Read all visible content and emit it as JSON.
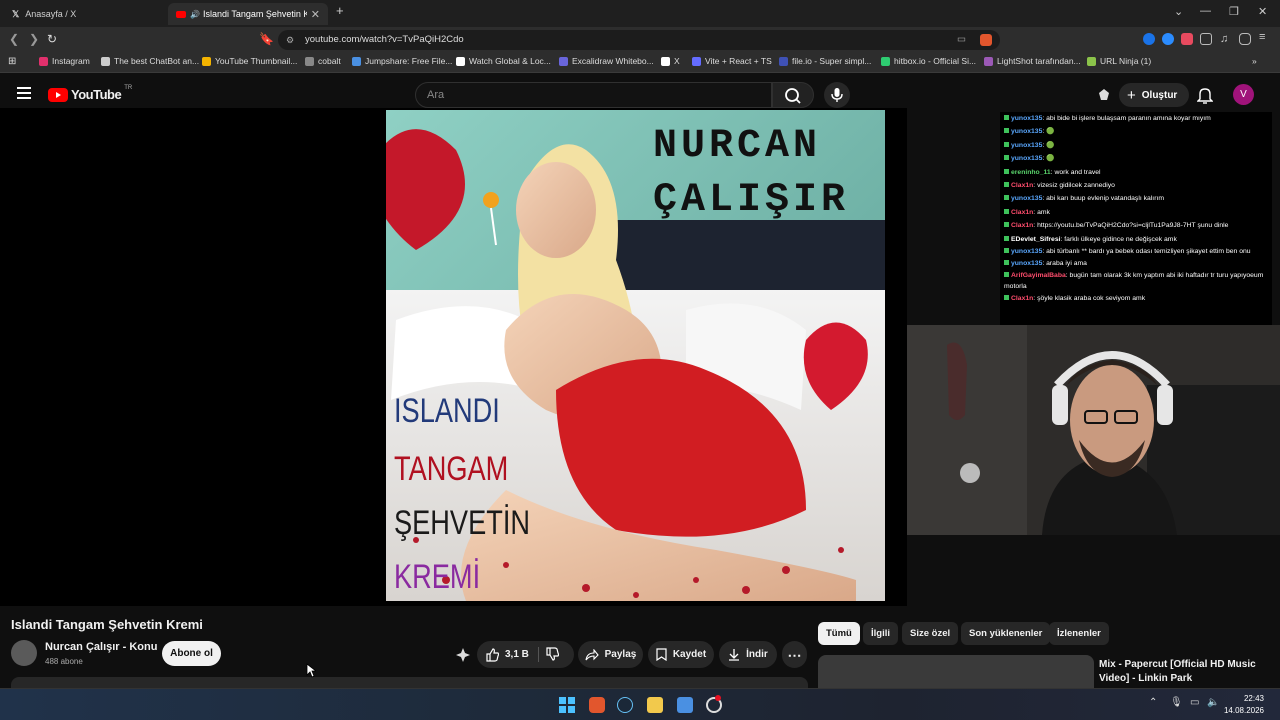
{
  "browser": {
    "tabs": [
      {
        "label": "Anasayfa / X"
      },
      {
        "label": "Islandi Tangam Şehvetin Kremi"
      }
    ],
    "url": "youtube.com/watch?v=TvPaQiH2Cdo",
    "bookmarks": [
      {
        "label": "Instagram",
        "color": "#e1306c"
      },
      {
        "label": "The best ChatBot an...",
        "color": "#cccccc"
      },
      {
        "label": "YouTube Thumbnail...",
        "color": "#f4b400"
      },
      {
        "label": "cobalt",
        "color": "#888888"
      },
      {
        "label": "Jumpshare: Free File...",
        "color": "#4a90e2"
      },
      {
        "label": "Watch Global & Loc...",
        "color": "#ffffff"
      },
      {
        "label": "Excalidraw Whitebo...",
        "color": "#6965db"
      },
      {
        "label": "X",
        "color": "#ffffff"
      },
      {
        "label": "Vite + React + TS",
        "color": "#646cff"
      },
      {
        "label": "file.io - Super simpl...",
        "color": "#3f51b5"
      },
      {
        "label": "hitbox.io - Official Si...",
        "color": "#2ecc71"
      },
      {
        "label": "LightShot tarafından...",
        "color": "#9b59b6"
      },
      {
        "label": "URL Ninja (1)",
        "color": "#8bc34a"
      }
    ]
  },
  "youtube": {
    "logo": "YouTube",
    "region": "TR",
    "search_placeholder": "Ara",
    "create_label": "Oluştur",
    "avatar_letter": "V"
  },
  "thumbnail": {
    "title_line1": "NURCAN",
    "title_line2": "ÇALIŞIR",
    "words": [
      "ISLANDI",
      "TANGAM",
      "ŞEHVETİN",
      "KREMİ"
    ]
  },
  "chat": [
    {
      "user": "yunox135",
      "color": "#5aa8ff",
      "text": ": abi bide bi işlere bulaşsam paranın amına koyar mıyım"
    },
    {
      "user": "yunox135",
      "color": "#5aa8ff",
      "text": ": 🟢"
    },
    {
      "user": "yunox135",
      "color": "#5aa8ff",
      "text": ": 🟢"
    },
    {
      "user": "yunox135",
      "color": "#5aa8ff",
      "text": ": 🟢"
    },
    {
      "user": "ereninho_11",
      "color": "#59d36b",
      "text": ": work and travel"
    },
    {
      "user": "Clax1n",
      "color": "#ff4d6d",
      "text": ": vizesiz gidilcek zannediyo"
    },
    {
      "user": "yunox135",
      "color": "#5aa8ff",
      "text": ": abi karı buup evlenip vatandaşlı kalırım"
    },
    {
      "user": "Clax1n",
      "color": "#ff4d6d",
      "text": ": amk"
    },
    {
      "user": "Clax1n",
      "color": "#ff4d6d",
      "text": ": https://youtu.be/TvPaQiH2Cdo?si=cljlTu1Pa9J8-7HT şunu dinle"
    },
    {
      "user": "EDevlet_Sifresi",
      "color": "#ffffff",
      "text": ": farklı ülkeye gidince ne değişcek amk"
    },
    {
      "user": "yunox135",
      "color": "#5aa8ff",
      "text": ": abi türbanlı ** bardı ya bebek odası temizliyen şikayet ettim ben onu"
    },
    {
      "user": "yunox135",
      "color": "#5aa8ff",
      "text": ": araba iyi ama"
    },
    {
      "user": "ArifGayimalBaba",
      "color": "#ff4d6d",
      "text": ": bugün tam olarak 3k km yaptım abi iki haftadır tr turu yapıyoeum motorla"
    },
    {
      "user": "Clax1n",
      "color": "#ff4d6d",
      "text": ": şöyle klasik araba cok seviyom amk"
    }
  ],
  "video": {
    "title": "Islandi Tangam Şehvetin Kremi",
    "channel": "Nurcan Çalışır - Konu",
    "subscribers": "488 abone",
    "subscribe_label": "Abone ol",
    "likes": "3,1 B",
    "share_label": "Paylaş",
    "save_label": "Kaydet",
    "download_label": "İndir"
  },
  "chips": [
    "Tümü",
    "İlgili",
    "Size özel",
    "Son yüklenenler",
    "İzlenenler"
  ],
  "recommendation": {
    "title": "Mix - Papercut [Official HD Music Video] - Linkin Park"
  },
  "taskbar": {
    "time": "22:43",
    "date": "14.08.2026"
  }
}
